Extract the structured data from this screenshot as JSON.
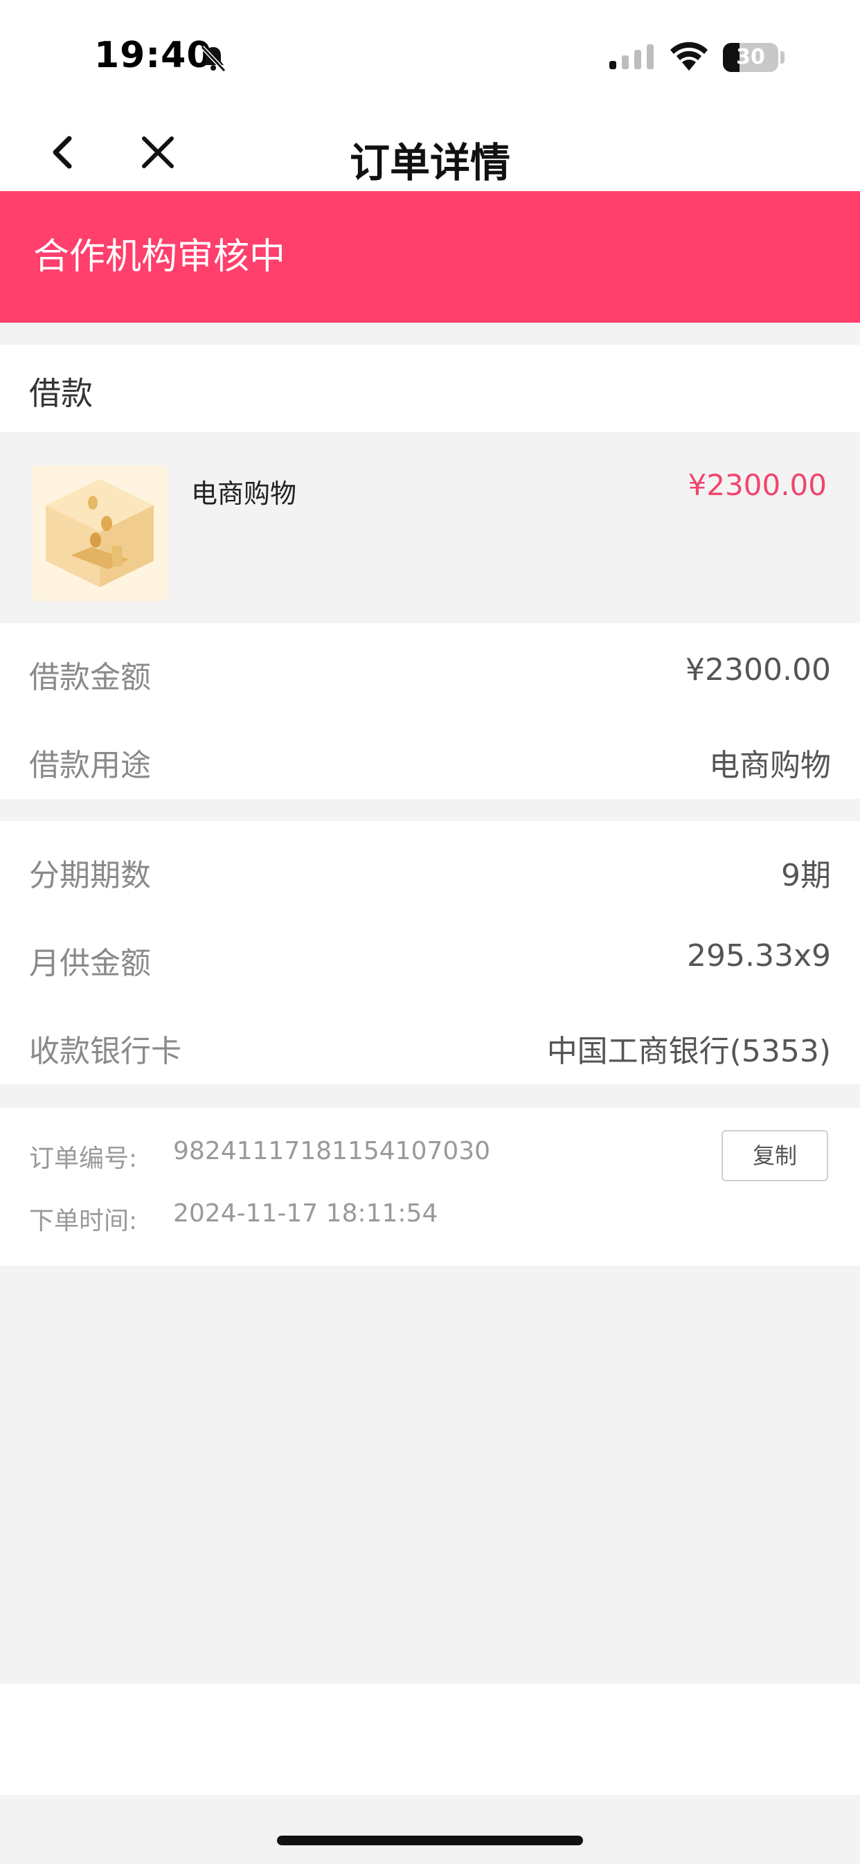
{
  "status_bar": {
    "time": "19:40",
    "battery_level": "30",
    "battery_fraction": 0.3,
    "icons": [
      "bell-muted-icon",
      "cellular-signal-icon",
      "wifi-icon",
      "battery-icon"
    ]
  },
  "nav": {
    "title": "订单详情",
    "back_icon": "chevron-left-icon",
    "close_icon": "close-icon"
  },
  "banner": {
    "text": "合作机构审核中",
    "color": "#ff3f6c"
  },
  "loan": {
    "section_label": "借款",
    "product": {
      "name": "电商购物",
      "price": "¥2300.00",
      "price_color": "#f0456d",
      "thumbnail_icon": "coin-box-icon"
    },
    "details": [
      {
        "label": "借款金额",
        "value": "¥2300.00"
      },
      {
        "label": "借款用途",
        "value": "电商购物"
      }
    ]
  },
  "plan": {
    "details": [
      {
        "label": "分期期数",
        "value": "9期"
      },
      {
        "label": "月供金额",
        "value": "295.33x9"
      },
      {
        "label": "收款银行卡",
        "value": "中国工商银行(5353)"
      }
    ]
  },
  "order": {
    "number_label": "订单编号:",
    "number_value": "98241117181154107030",
    "copy_button": "复制",
    "time_label": "下单时间:",
    "time_value": "2024-11-17 18:11:54"
  }
}
